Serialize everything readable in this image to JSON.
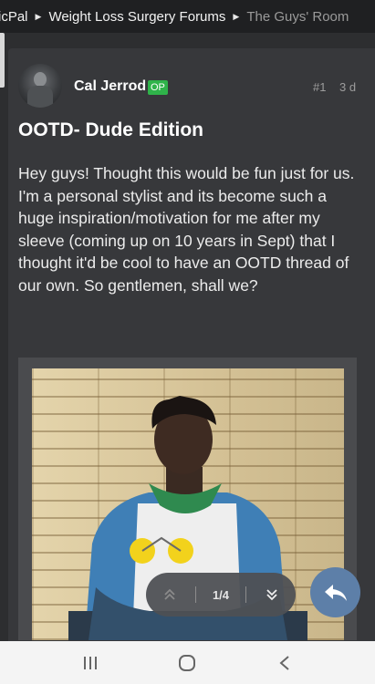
{
  "breadcrumb": {
    "items": [
      {
        "label": "icPal"
      },
      {
        "label": "Weight Loss Surgery Forums"
      },
      {
        "label": "The Guys' Room"
      }
    ]
  },
  "post": {
    "author": "Cal Jerrod",
    "op_badge": "OP",
    "number": "#1",
    "age": "3 d",
    "title": "OOTD- Dude Edition",
    "body": "Hey guys! Thought this would be fun just for us. I'm a personal stylist and its become such a huge inspiration/motivation for me after my sleeve (coming up on 10 years in Sept) that I thought it'd be cool to have an OOTD thread of our own. So gentlemen, shall we?"
  },
  "pager": {
    "label": "1/4",
    "up_icon": "double-chevron-up-icon",
    "down_icon": "double-chevron-down-icon"
  },
  "colors": {
    "background": "#2d2e30",
    "card": "#37383b",
    "op_badge": "#2fb34a",
    "reply_button": "#5d7fa8"
  }
}
